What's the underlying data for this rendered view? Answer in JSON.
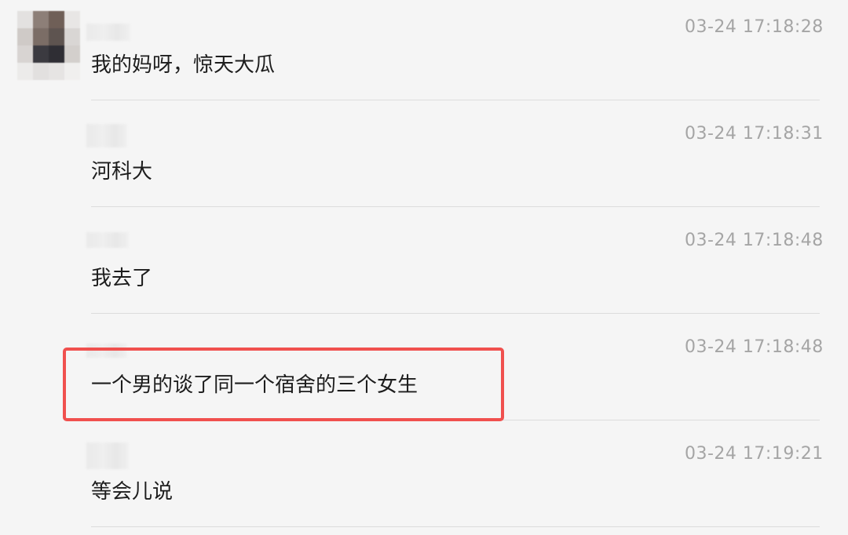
{
  "messages": [
    {
      "time": "03-24 17:18:28",
      "text": "我的妈呀，惊天大瓜"
    },
    {
      "time": "03-24 17:18:31",
      "text": "河科大"
    },
    {
      "time": "03-24 17:18:48",
      "text": "我去了"
    },
    {
      "time": "03-24 17:18:48",
      "text": "一个男的谈了同一个宿舍的三个女生"
    },
    {
      "time": "03-24 17:19:21",
      "text": "等会儿说"
    }
  ],
  "colors": {
    "background": "#f5f5f5",
    "highlight": "#f0504e",
    "timestamp": "#a5a5a5",
    "message_text": "#1d1d1d"
  }
}
